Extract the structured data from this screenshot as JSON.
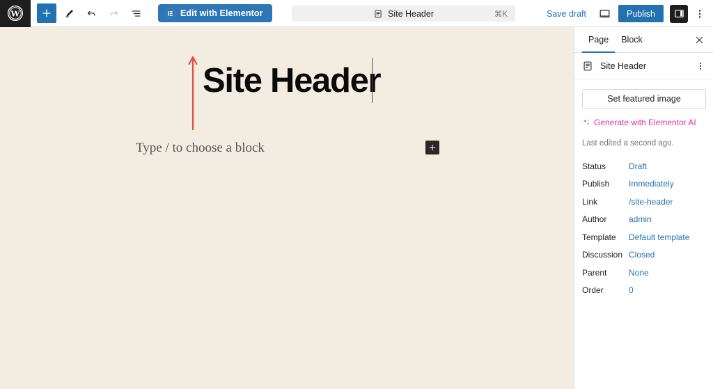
{
  "topbar": {
    "wp_logo_icon": "wordpress-logo-icon",
    "left_tools": [
      {
        "name": "block-inserter-button",
        "icon": "plus-icon",
        "state": "primary"
      },
      {
        "name": "tools-pencil-button",
        "icon": "pencil-icon",
        "state": "default"
      },
      {
        "name": "undo-button",
        "icon": "undo-arrow-icon",
        "state": "default"
      },
      {
        "name": "redo-button",
        "icon": "redo-arrow-icon",
        "state": "disabled"
      },
      {
        "name": "document-overview-button",
        "icon": "list-view-icon",
        "state": "default"
      }
    ],
    "elementor_button_label": "Edit with Elementor",
    "elementor_icon": "elementor-logo-icon",
    "command_center": {
      "icon": "page-document-icon",
      "title": "Site Header",
      "shortcut": "⌘K"
    },
    "save_draft_label": "Save draft",
    "preview_icon": "desktop-preview-icon",
    "publish_label": "Publish",
    "sidebar_toggle_icon": "settings-sidebar-icon",
    "options_icon": "vertical-ellipsis-icon"
  },
  "canvas": {
    "background_color": "#f3ede1",
    "post_title": "Site Header",
    "block_placeholder": "Type / to choose a block",
    "inserter_icon": "plus-icon",
    "annotation": {
      "type": "arrow",
      "color": "#e8493a",
      "points_to": "Edit with Elementor"
    }
  },
  "sidebar": {
    "tabs": [
      {
        "label": "Page",
        "active": true
      },
      {
        "label": "Block",
        "active": false
      }
    ],
    "close_icon": "close-icon",
    "document": {
      "icon": "page-document-icon",
      "title": "Site Header",
      "actions_icon": "vertical-ellipsis-icon"
    },
    "featured_image_label": "Set featured image",
    "ai_link_label": "Generate with Elementor AI",
    "ai_icon": "sparkles-icon",
    "ai_color": "#d9359e",
    "last_edited": "Last edited a second ago.",
    "meta": [
      {
        "label": "Status",
        "value": "Draft"
      },
      {
        "label": "Publish",
        "value": "Immediately"
      },
      {
        "label": "Link",
        "value": "/site-header"
      },
      {
        "label": "Author",
        "value": "admin"
      },
      {
        "label": "Template",
        "value": "Default template"
      },
      {
        "label": "Discussion",
        "value": "Closed"
      },
      {
        "label": "Parent",
        "value": "None"
      },
      {
        "label": "Order",
        "value": "0"
      }
    ]
  },
  "colors": {
    "accent_blue": "#2271b1",
    "elementor_pink": "#d9359e",
    "canvas_cream": "#f3ede1",
    "dark": "#1e1e1e"
  }
}
